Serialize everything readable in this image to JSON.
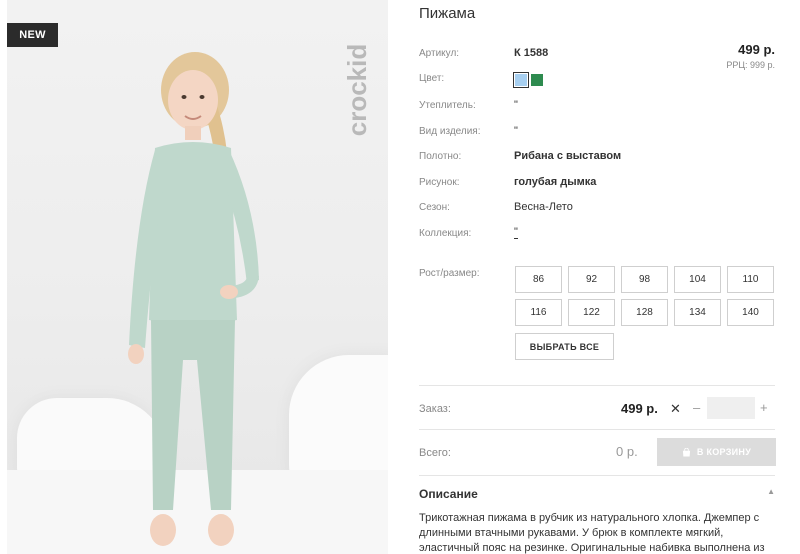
{
  "image": {
    "badge": "NEW",
    "brand": "crockid"
  },
  "product": {
    "title": "Пижама",
    "price": "499 р.",
    "rrp": "РРЦ: 999 р."
  },
  "attributes": {
    "article": {
      "label": "Артикул:",
      "value": "К 1588"
    },
    "color": {
      "label": "Цвет:",
      "swatches": [
        "#a7cff0",
        "#2e8b4f"
      ],
      "selected": "#a7cff0"
    },
    "insulation": {
      "label": "Утеплитель:",
      "value": "\""
    },
    "product_type": {
      "label": "Вид изделия:",
      "value": "\""
    },
    "fabric": {
      "label": "Полотно:",
      "value": "Рибана с выставом"
    },
    "pattern": {
      "label": "Рисунок:",
      "value": "голубая дымка"
    },
    "season": {
      "label": "Сезон:",
      "value": "Весна-Лето"
    },
    "collection": {
      "label": "Коллекция:",
      "value": "\""
    }
  },
  "sizes": {
    "label": "Рост/размер:",
    "options": [
      "86",
      "92",
      "98",
      "104",
      "110",
      "116",
      "122",
      "128",
      "134",
      "140"
    ],
    "select_all": "ВЫБРАТЬ ВСЕ"
  },
  "order": {
    "label": "Заказ:",
    "price": "499 р.",
    "times": "✕",
    "minus": "–",
    "plus": "+",
    "quantity": ""
  },
  "total": {
    "label": "Всего:",
    "value": "0 р.",
    "cart_button": "В КОРЗИНУ",
    "cart_icon": "shopping-bag-icon"
  },
  "description": {
    "title": "Описание",
    "text": "Трикотажная пижама в рубчик из натурального хлопка. Джемпер с длинными втачными рукавами. У брюк в комплекте мягкий, эластичный пояс на резинке. Оригинальные набивка выполнена из"
  },
  "colors": {
    "accent_dark": "#2b2b2b",
    "outfit": "#bfd8cc",
    "button_disabled": "#dcdcdc"
  }
}
